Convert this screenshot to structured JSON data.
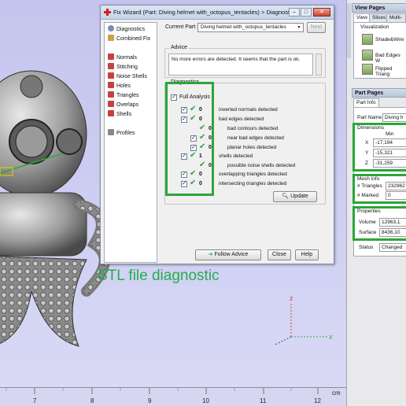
{
  "dialog": {
    "title": "Fix Wizard (Part: Diving helmet with_octopus_tentacles) > Diagnostics",
    "current_part_label": "Current Part:",
    "current_part_value": "Diving helmet with_octopus_tentacles",
    "next_label": "Next",
    "advice_title": "Advice",
    "advice_text": "No more errors are detected. It seems that the part is ok.",
    "diagnostics_title": "Diagnostics",
    "full_analysis_label": "Full Analysis",
    "update_label": "Update",
    "follow_advice_label": "Follow Advice",
    "close_label": "Close",
    "help_label": "Help"
  },
  "nav": {
    "items": [
      {
        "label": "Diagnostics",
        "color": "#7a8fb8"
      },
      {
        "label": "Combined Fix",
        "color": "#c9a24a"
      },
      {
        "label": "Normals",
        "color": "#c74040"
      },
      {
        "label": "Stitching",
        "color": "#c74040"
      },
      {
        "label": "Noise Shells",
        "color": "#c74040"
      },
      {
        "label": "Holes",
        "color": "#c74040"
      },
      {
        "label": "Triangles",
        "color": "#c74040"
      },
      {
        "label": "Overlaps",
        "color": "#c74040"
      },
      {
        "label": "Shells",
        "color": "#c74040"
      },
      {
        "label": "Profiles",
        "color": "#888888"
      }
    ]
  },
  "diagnostics": [
    {
      "checked": true,
      "count": "0",
      "label": "inverted normals detected"
    },
    {
      "checked": true,
      "count": "0",
      "label": "bad edges detected"
    },
    {
      "checked": false,
      "count": "0",
      "label": "bad contours detected"
    },
    {
      "checked": true,
      "count": "0",
      "label": "near bad edges detected"
    },
    {
      "checked": true,
      "count": "0",
      "label": "planar holes detected"
    },
    {
      "checked": true,
      "count": "1",
      "label": "shells detected"
    },
    {
      "checked": false,
      "count": "0",
      "label": "possible noise shells detected"
    },
    {
      "checked": true,
      "count": "0",
      "label": "overlapping triangles detected"
    },
    {
      "checked": true,
      "count": "0",
      "label": "intersecting triangles detected"
    }
  ],
  "caption": "STL file diagnostic",
  "ruler": {
    "ticks": [
      "7",
      "8",
      "9",
      "10",
      "11",
      "12"
    ],
    "unit": "cm"
  },
  "axes": {
    "z": "z",
    "x": "x"
  },
  "view_pages": {
    "title": "View Pages",
    "tabs": [
      "View",
      "Slices",
      "Multi-Se"
    ],
    "visualization_label": "Visualization",
    "items": [
      "Shade&Wire",
      "Bad Edges W",
      "Flipped Triang"
    ]
  },
  "part_pages": {
    "title": "Part Pages",
    "tab": "Part Info",
    "part_name_label": "Part Name",
    "part_name_value": "Diving h",
    "dimensions_title": "Dimensions",
    "min_label": "Min",
    "x_label": "X",
    "x_value": "-17,194",
    "y_label": "Y",
    "y_value": "-15,321",
    "z_label": "Z",
    "z_value": "-31,259",
    "mesh_info_title": "Mesh info",
    "triangles_label": "# Triangles",
    "triangles_value": "232962",
    "marked_label": "# Marked",
    "marked_value": "0",
    "properties_title": "Properties",
    "volume_label": "Volume",
    "volume_value": "12963,1",
    "surface_label": "Surface",
    "surface_value": "8436,10",
    "status_label": "Status",
    "status_value": "Changed"
  },
  "colors": {
    "highlight": "#2aa63a",
    "caption": "#22b04a",
    "viewport_bg": "#c9c9f0"
  }
}
